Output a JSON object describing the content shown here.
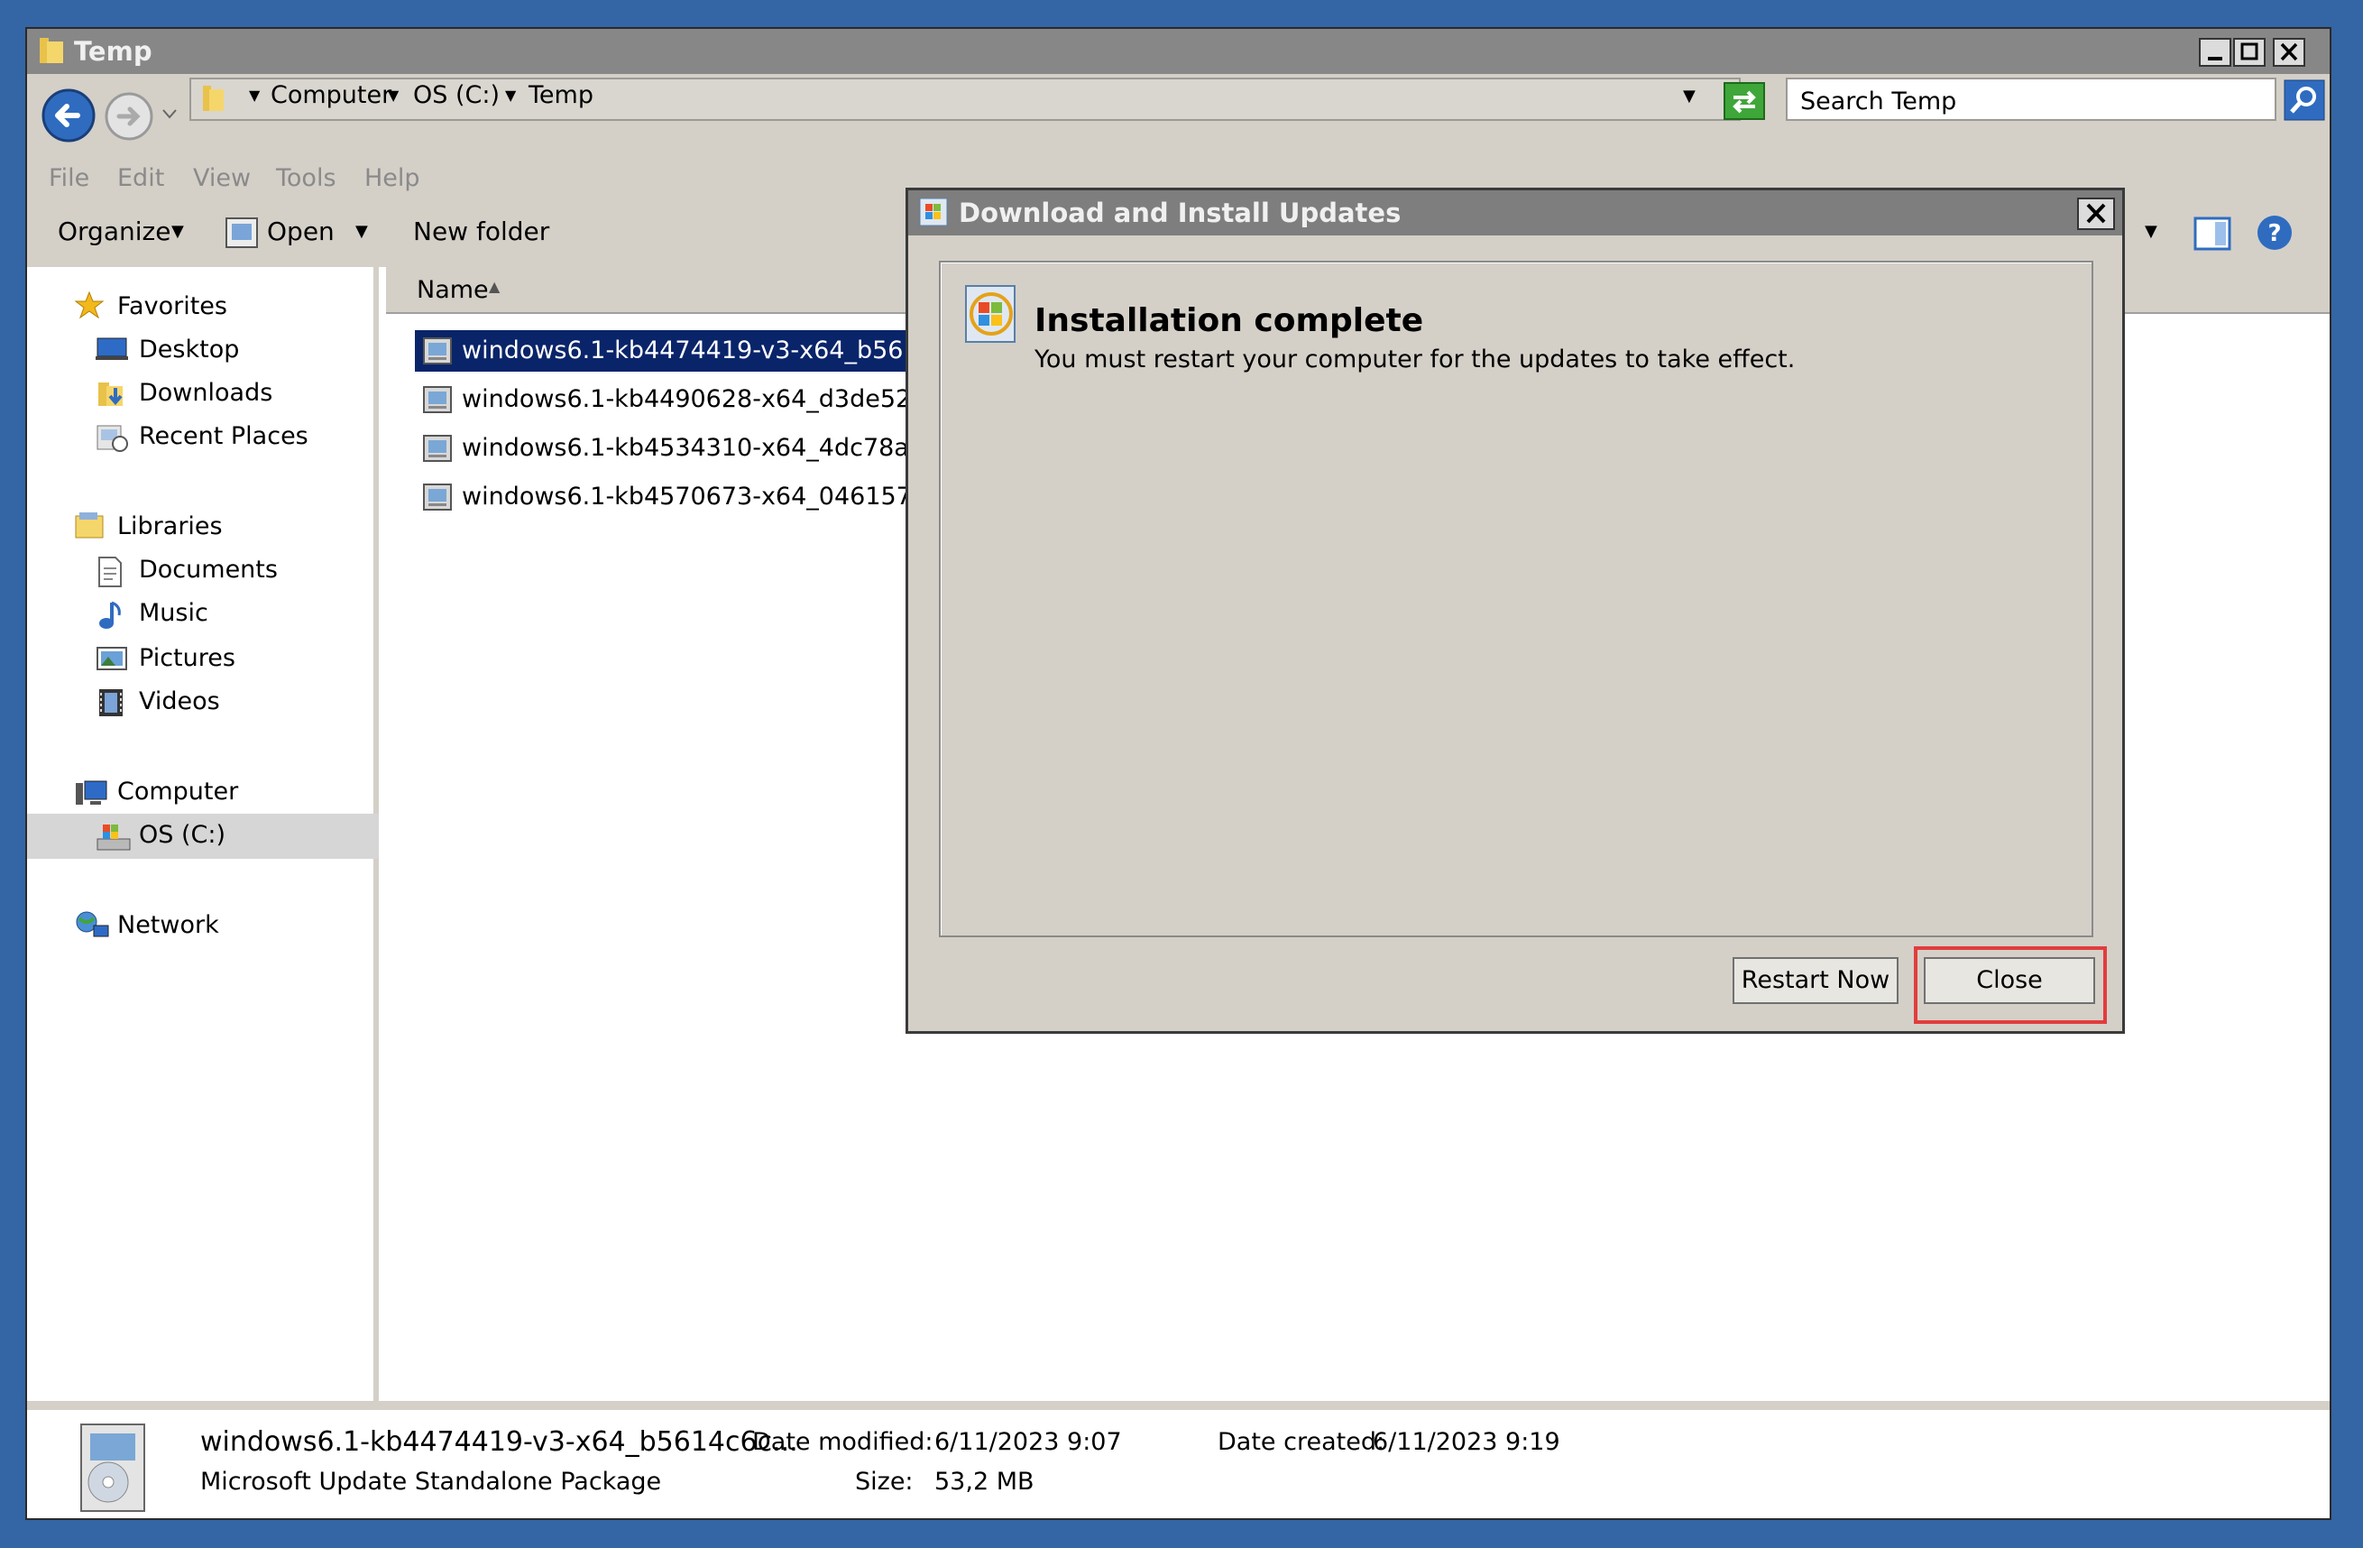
{
  "window": {
    "title": "Temp"
  },
  "address_bar": {
    "crumbs": [
      "Computer",
      "OS (C:)",
      "Temp"
    ]
  },
  "search": {
    "placeholder": "Search Temp"
  },
  "menu": [
    "File",
    "Edit",
    "View",
    "Tools",
    "Help"
  ],
  "toolbar": {
    "organize": "Organize",
    "open": "Open",
    "new_folder": "New folder"
  },
  "nav": {
    "favorites": "Favorites",
    "desktop": "Desktop",
    "downloads": "Downloads",
    "recent_places": "Recent Places",
    "libraries": "Libraries",
    "documents": "Documents",
    "music": "Music",
    "pictures": "Pictures",
    "videos": "Videos",
    "computer": "Computer",
    "os_drive": "OS (C:)",
    "network": "Network"
  },
  "file_list": {
    "column_name": "Name",
    "files": [
      "windows6.1-kb4474419-v3-x64_b5614c6c",
      "windows6.1-kb4490628-x64_d3de52d698",
      "windows6.1-kb4534310-x64_4dc78a6eeb",
      "windows6.1-kb4570673-x64_046157fddc"
    ]
  },
  "details": {
    "file_name": "windows6.1-kb4474419-v3-x64_b5614c6c...",
    "file_type": "Microsoft Update Standalone Package",
    "date_modified_label": "Date modified:",
    "date_modified": "6/11/2023 9:07",
    "size_label": "Size:",
    "size": "53,2 MB",
    "date_created_label": "Date created:",
    "date_created": "6/11/2023 9:19"
  },
  "dialog": {
    "title": "Download and Install Updates",
    "heading": "Installation complete",
    "message": "You must restart your computer for the updates to take effect.",
    "restart_button": "Restart Now",
    "close_button": "Close",
    "highlight_color": "#e23c3c"
  }
}
